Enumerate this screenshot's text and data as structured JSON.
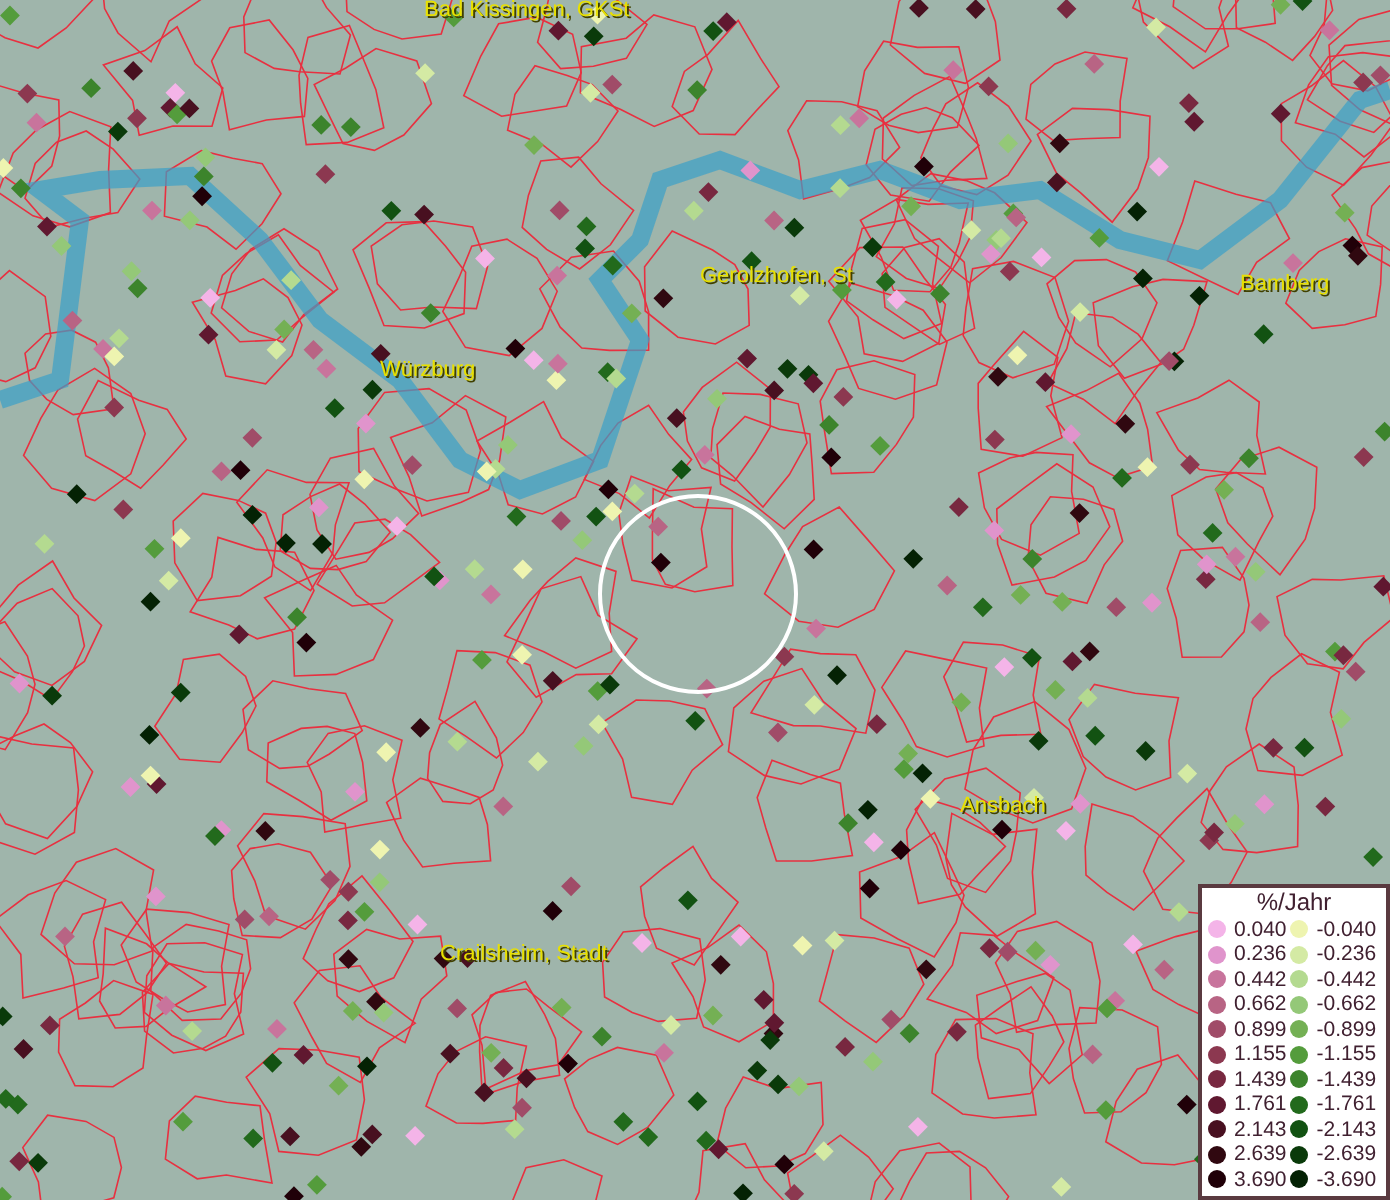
{
  "map": {
    "places": [
      {
        "name": "Bad Kissingen, GKSt"
      },
      {
        "name": "Gerolzhofen, St"
      },
      {
        "name": "Bamberg"
      },
      {
        "name": "Würzburg"
      },
      {
        "name": "Ansbach"
      },
      {
        "name": "Crailsheim, Stadt"
      }
    ]
  },
  "legend": {
    "title": "%/Jahr",
    "positive": [
      {
        "value": "0.040",
        "color": "#f4b4e8"
      },
      {
        "value": "0.236",
        "color": "#e094cc"
      },
      {
        "value": "0.442",
        "color": "#c8749c"
      },
      {
        "value": "0.662",
        "color": "#b86484"
      },
      {
        "value": "0.899",
        "color": "#a04c68"
      },
      {
        "value": "1.155",
        "color": "#8c3850"
      },
      {
        "value": "1.439",
        "color": "#782840"
      },
      {
        "value": "1.761",
        "color": "#601830"
      },
      {
        "value": "2.143",
        "color": "#481020"
      },
      {
        "value": "2.639",
        "color": "#300810"
      },
      {
        "value": "3.690",
        "color": "#200008"
      }
    ],
    "negative": [
      {
        "value": "-0.040",
        "color": "#eef4b0"
      },
      {
        "value": "-0.236",
        "color": "#d4eaa4"
      },
      {
        "value": "-0.442",
        "color": "#b4da90"
      },
      {
        "value": "-0.662",
        "color": "#94c878"
      },
      {
        "value": "-0.899",
        "color": "#74b054"
      },
      {
        "value": "-1.155",
        "color": "#549c3c"
      },
      {
        "value": "-1.439",
        "color": "#3c842c"
      },
      {
        "value": "-1.761",
        "color": "#226a1c"
      },
      {
        "value": "-2.143",
        "color": "#125212"
      },
      {
        "value": "-2.639",
        "color": "#0a3a0a"
      },
      {
        "value": "-3.690",
        "color": "#042204"
      }
    ]
  }
}
